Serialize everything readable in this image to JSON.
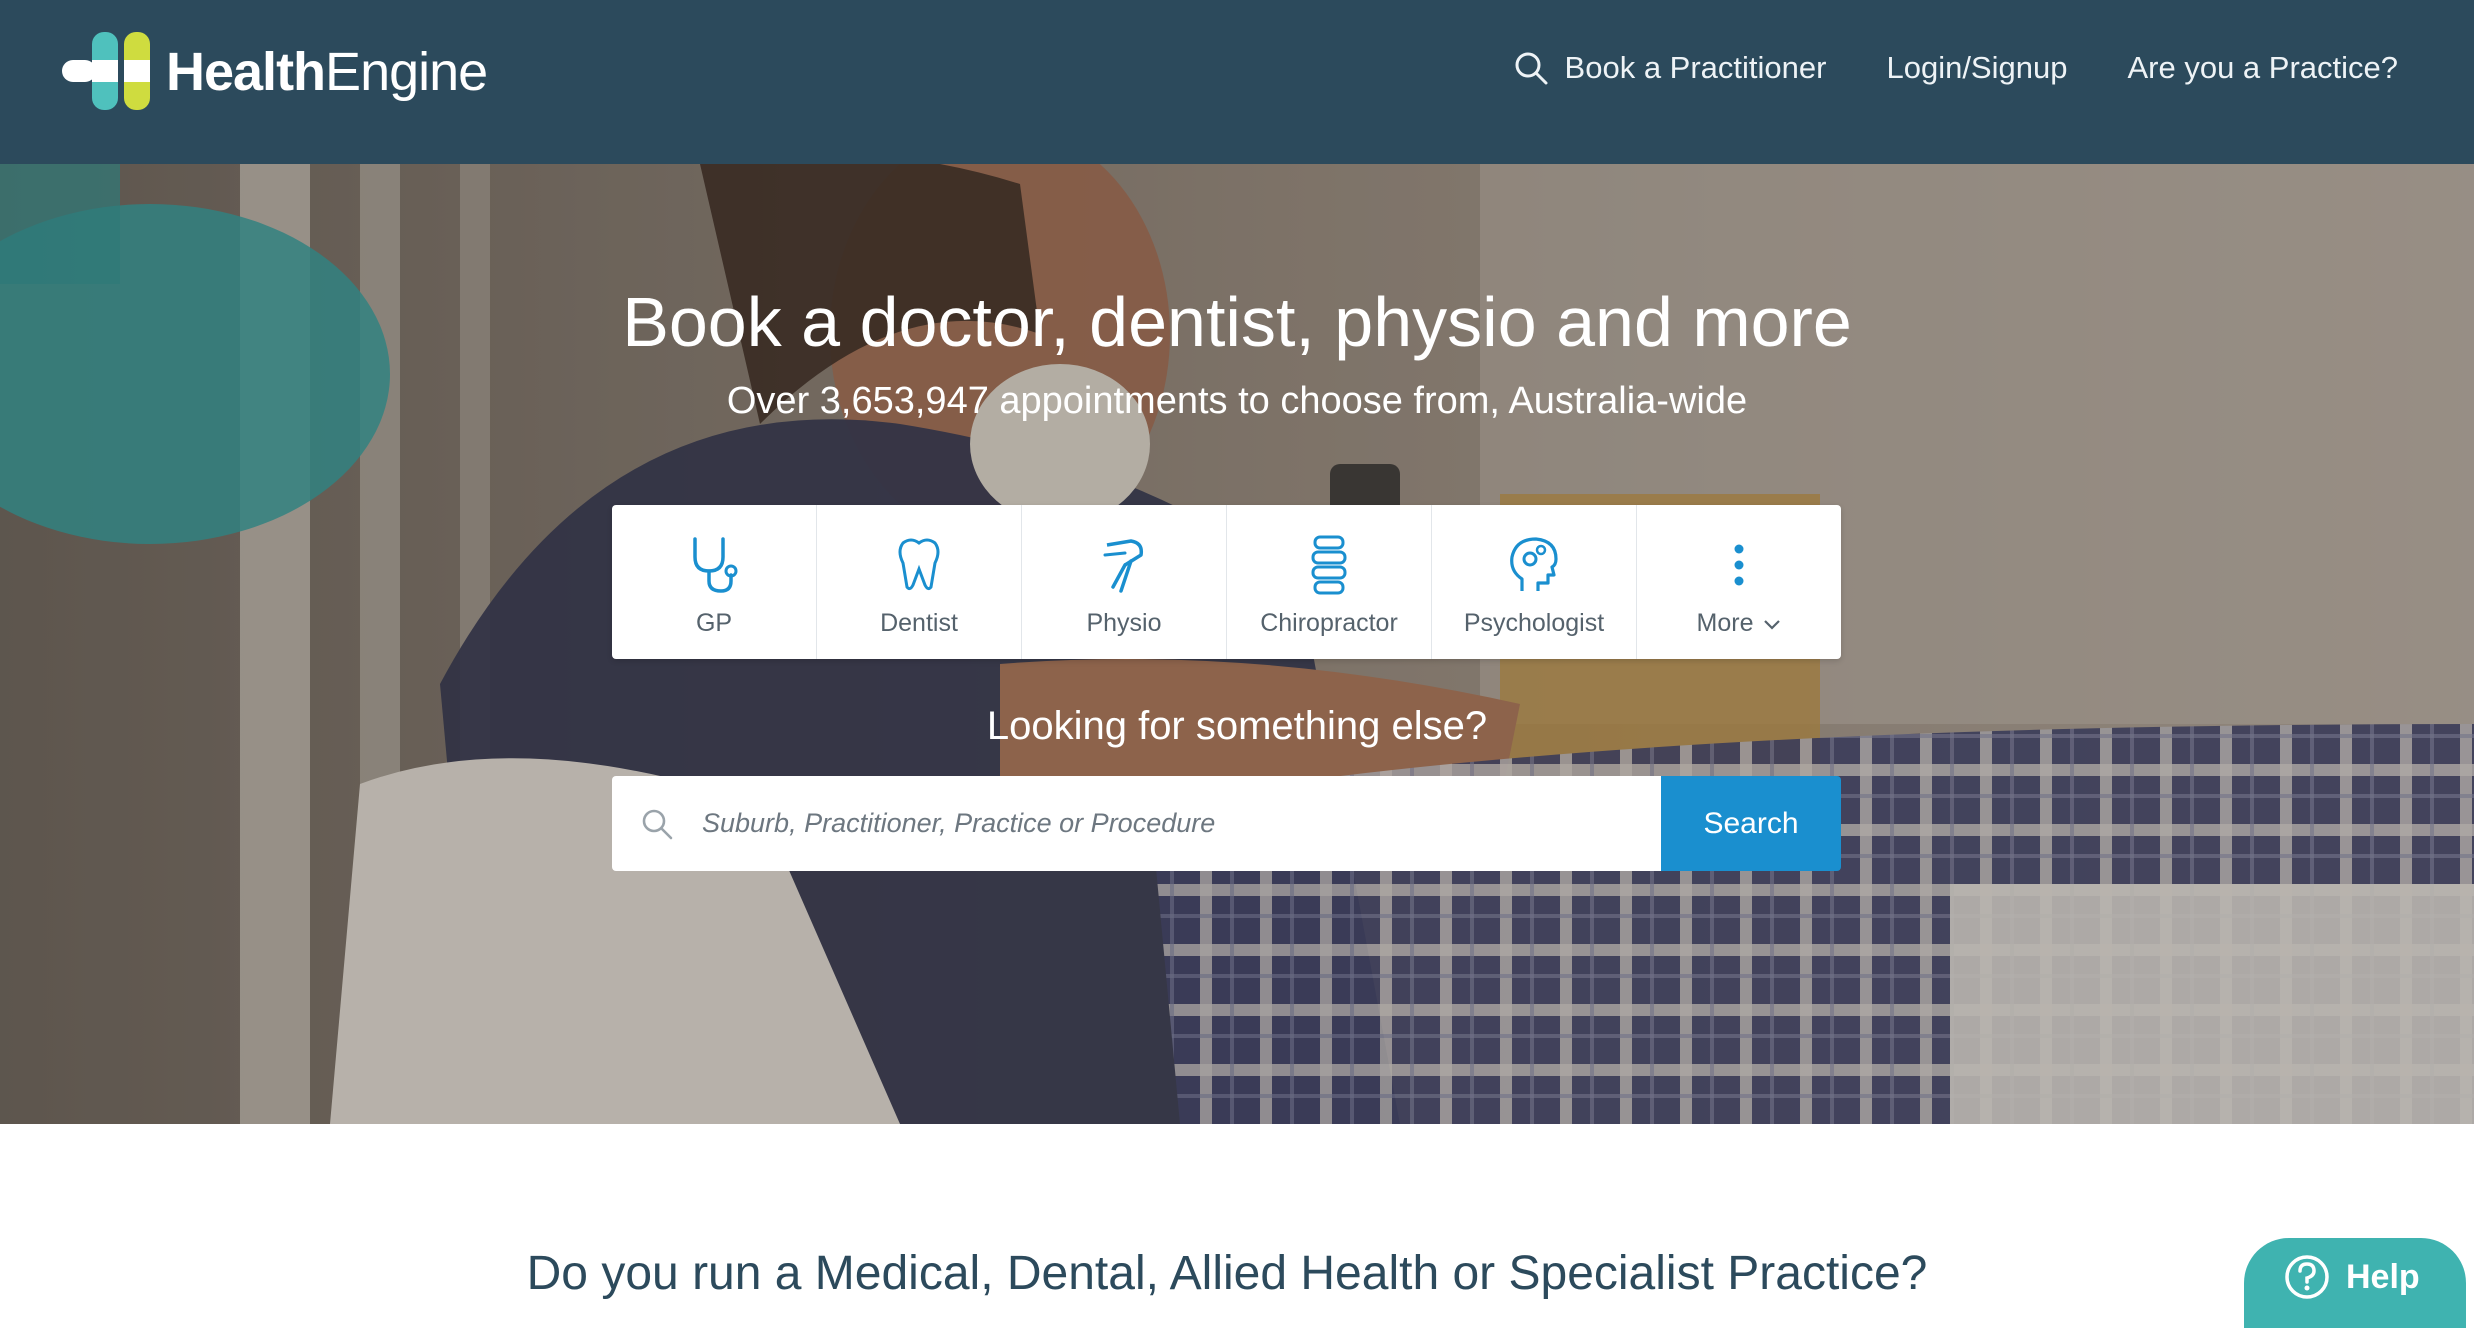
{
  "brand": {
    "name_bold": "Health",
    "name_regular": "Engine",
    "colors": {
      "navy": "#2c4a5c",
      "teal": "#4fc1bd",
      "lime": "#cfdc3f",
      "blue": "#1a8fcf",
      "help": "#3fb3b0"
    }
  },
  "nav": {
    "items": [
      {
        "label": "Book a Practitioner",
        "icon": "search-icon"
      },
      {
        "label": "Login/Signup"
      },
      {
        "label": "Are you a Practice?"
      }
    ]
  },
  "hero": {
    "title": "Book a doctor, dentist, physio and more",
    "subtitle": "Over 3,653,947 appointments to choose from, Australia-wide",
    "categories": [
      {
        "label": "GP",
        "icon": "stethoscope-icon"
      },
      {
        "label": "Dentist",
        "icon": "tooth-icon"
      },
      {
        "label": "Physio",
        "icon": "knee-joint-icon"
      },
      {
        "label": "Chiropractor",
        "icon": "spine-icon"
      },
      {
        "label": "Psychologist",
        "icon": "head-gears-icon"
      },
      {
        "label": "More",
        "icon": "vertical-dots-icon"
      }
    ],
    "looking_text": "Looking for something else?",
    "search": {
      "placeholder": "Suburb, Practitioner, Practice or Procedure",
      "value": "",
      "button_label": "Search"
    }
  },
  "practice_section": {
    "heading": "Do you run a Medical, Dental, Allied Health or Specialist Practice?"
  },
  "help": {
    "label": "Help",
    "icon": "question-circle-icon"
  }
}
